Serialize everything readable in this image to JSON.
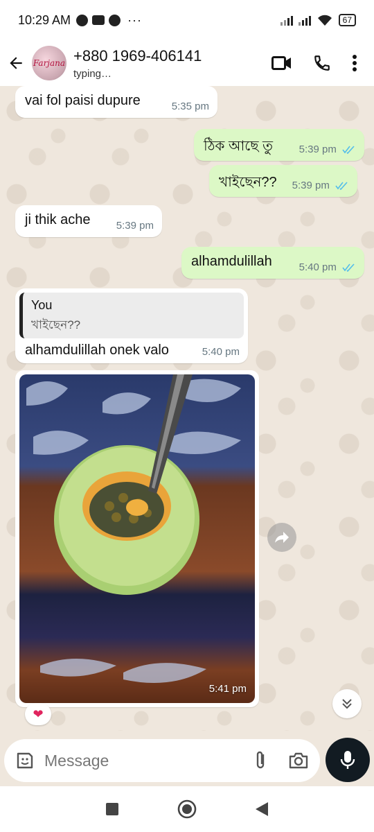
{
  "status_bar": {
    "time": "10:29 AM",
    "dots": "···",
    "battery": "67"
  },
  "header": {
    "contact_name": "+880 1969-406141",
    "contact_status": "typing…",
    "avatar_text": "Farjana"
  },
  "messages": [
    {
      "direction": "in",
      "text": "vai fol paisi dupure",
      "time": "5:35 pm"
    },
    {
      "direction": "out",
      "text": "ঠিক আছে তু",
      "time": "5:39 pm",
      "read": true
    },
    {
      "direction": "out",
      "text": "খাইছেন??",
      "time": "5:39 pm",
      "read": true
    },
    {
      "direction": "in",
      "text": "ji thik ache",
      "time": "5:39 pm"
    },
    {
      "direction": "out",
      "text": "alhamdulillah",
      "time": "5:40 pm",
      "read": true
    },
    {
      "direction": "in",
      "text": "alhamdulillah onek valo",
      "time": "5:40 pm",
      "quote": {
        "author": "You",
        "text": "খাইছেন??"
      }
    },
    {
      "direction": "in",
      "type": "image",
      "time": "5:41 pm",
      "reaction": "❤"
    }
  ],
  "composer": {
    "placeholder": "Message"
  },
  "colors": {
    "outgoing_bubble": "#dcf8c6",
    "incoming_bubble": "#ffffff",
    "read_tick": "#53bdeb",
    "chat_background": "#efe7dd",
    "mic_button": "#121b22"
  }
}
